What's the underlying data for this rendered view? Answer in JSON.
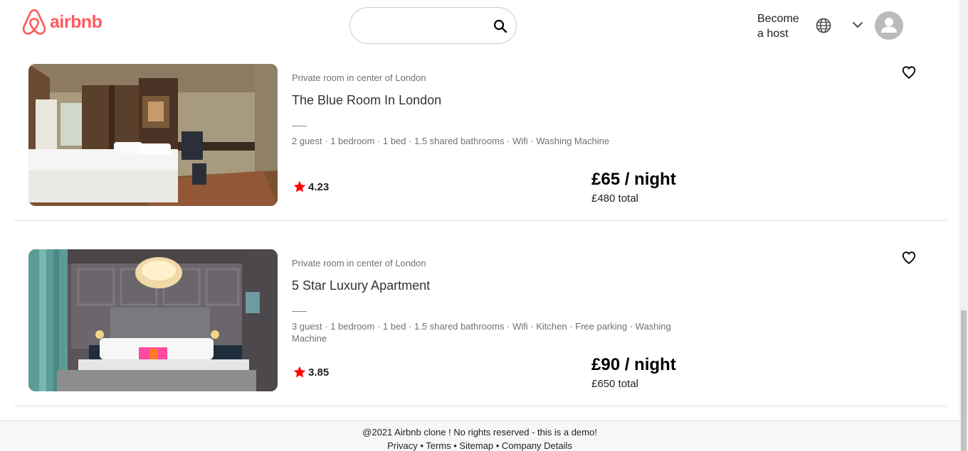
{
  "header": {
    "logo_text": "airbnb",
    "search_placeholder": "",
    "become_host": "Become a host"
  },
  "listings": [
    {
      "subtitle": "Private room in center of London",
      "title": "The Blue Room In London",
      "info": "2 guest · 1 bedroom · 1 bed · 1.5 shared bathrooms · Wifi · Washing Machine",
      "rating": "4.23",
      "price": "£65 / night",
      "total": "£480 total"
    },
    {
      "subtitle": "Private room in center of London",
      "title": "5 Star Luxury Apartment",
      "info": "3 guest · 1 bedroom · 1 bed · 1.5 shared bathrooms · Wifi · Kitchen · Free parking · Washing Machine",
      "rating": "3.85",
      "price": "£90 / night",
      "total": "£650 total"
    }
  ],
  "footer": {
    "copyright": "@2021 Airbnb clone ! No rights reserved - this is a demo!",
    "links": [
      "Privacy",
      "Terms",
      "Sitemap",
      "Company Details"
    ],
    "separator": " • "
  },
  "colors": {
    "brand": "#FF5A5F",
    "star": "#FF0000"
  }
}
